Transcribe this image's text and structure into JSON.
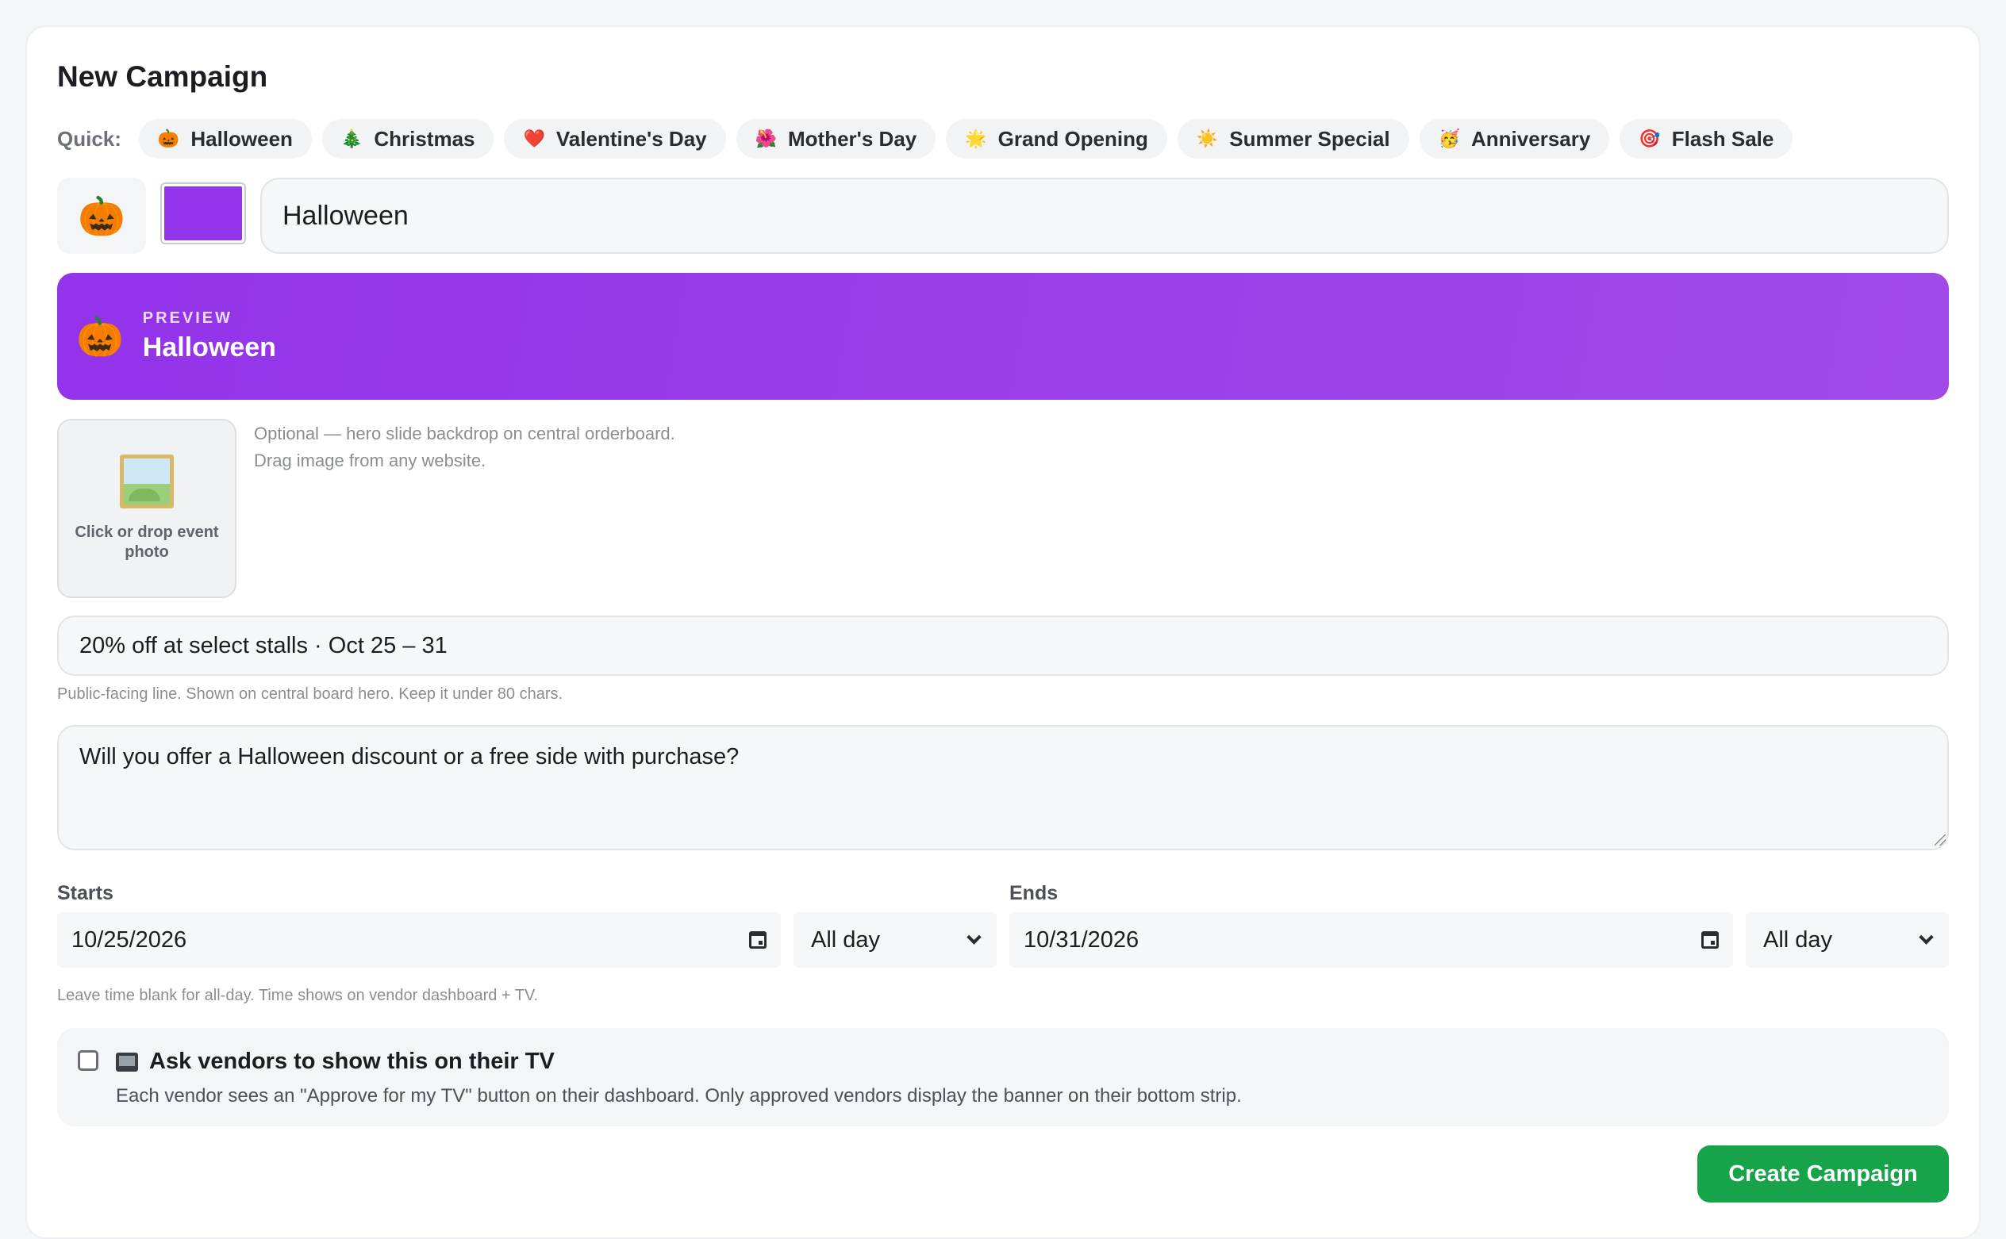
{
  "form": {
    "title": "New Campaign",
    "quick_label": "Quick:",
    "quick_presets": [
      {
        "icon": "🎃",
        "icon_name": "pumpkin-icon",
        "label": "Halloween"
      },
      {
        "icon": "🎄",
        "icon_name": "christmas-tree-icon",
        "label": "Christmas"
      },
      {
        "icon": "❤️",
        "icon_name": "heart-icon",
        "label": "Valentine's Day"
      },
      {
        "icon": "🌺",
        "icon_name": "flower-icon",
        "label": "Mother's Day"
      },
      {
        "icon": "🌟",
        "icon_name": "star-icon",
        "label": "Grand Opening"
      },
      {
        "icon": "☀️",
        "icon_name": "sun-icon",
        "label": "Summer Special"
      },
      {
        "icon": "🥳",
        "icon_name": "party-face-icon",
        "label": "Anniversary"
      },
      {
        "icon": "🎯",
        "icon_name": "target-icon",
        "label": "Flash Sale"
      }
    ],
    "emoji": "🎃",
    "color": "#9333ea",
    "name_value": "Halloween",
    "preview": {
      "label": "PREVIEW",
      "title": "Halloween",
      "emoji": "🎃",
      "gradient_from": "#9333ea",
      "gradient_to": "#a04ae8"
    },
    "photo": {
      "drop_text": "Click or drop event photo",
      "hint_line1": "Optional — hero slide backdrop on central orderboard.",
      "hint_line2": "Drag image from any website."
    },
    "tagline": {
      "value": "20% off at select stalls · Oct 25 – 31",
      "hint": "Public-facing line. Shown on central board hero. Keep it under 80 chars."
    },
    "question": {
      "value": "Will you offer a Halloween discount or a free side with purchase?"
    },
    "starts": {
      "label": "Starts",
      "date": "10/25/2026",
      "time": "All day"
    },
    "ends": {
      "label": "Ends",
      "date": "10/31/2026",
      "time": "All day"
    },
    "time_hint": "Leave time blank for all-day. Time shows on vendor dashboard + TV.",
    "tv": {
      "checked": false,
      "title": "Ask vendors to show this on their TV",
      "description": "Each vendor sees an \"Approve for my TV\" button on their dashboard. Only approved vendors display the banner on their bottom strip."
    },
    "submit_label": "Create Campaign",
    "submit_color": "#16a34a"
  }
}
